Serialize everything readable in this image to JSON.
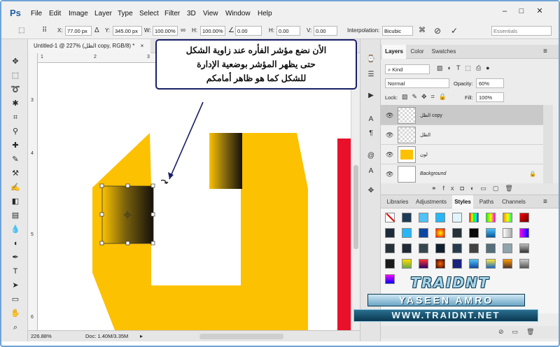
{
  "app": {
    "logo": "Ps",
    "menu": [
      "File",
      "Edit",
      "Image",
      "Layer",
      "Type",
      "Select",
      "Filter",
      "3D",
      "View",
      "Window",
      "Help"
    ],
    "window_controls": [
      "–",
      "□",
      "✕"
    ]
  },
  "options_bar": {
    "x_label": "X:",
    "x_value": "77.00 px",
    "y_label": "Y:",
    "y_value": "345.00 px",
    "w_label": "W:",
    "w_value": "100.00%",
    "h_label": "H:",
    "h_value": "100.00%",
    "angle_value": "0.00",
    "hskew_label": "H:",
    "hskew_value": "0.00",
    "vskew_label": "V:",
    "vskew_value": "0.00",
    "interp_label": "Interpolation:",
    "interp_value": "Bicubic",
    "workspace": "Essentials"
  },
  "document": {
    "tab_title": "Untitled-1 @ 227% (الظل copy, RGB/8) *",
    "tab_close": "×",
    "ruler_top": [
      "1",
      "2",
      "3",
      "4",
      "5",
      "6"
    ],
    "ruler_left": [
      "3",
      "4",
      "5",
      "6"
    ],
    "zoom": "226.88%",
    "doc_info": "Doc: 1.40M/3.35M"
  },
  "callout": {
    "lines": [
      "الأن نضع مؤشر الفأره عند زاوية الشكل",
      "حتى يظهر المؤشر بوضعية الإدارة",
      "للشكل كما هو ظاهر أمامكم"
    ]
  },
  "layers_panel": {
    "tabs": [
      "Layers",
      "Color",
      "Swatches"
    ],
    "kind_filter": "Kind",
    "blend_mode": "Normal",
    "opacity_label": "Opacity:",
    "opacity_value": "60%",
    "lock_label": "Lock:",
    "fill_label": "Fill:",
    "fill_value": "100%",
    "layers": [
      {
        "name": "الظل copy",
        "selected": true
      },
      {
        "name": "الظل",
        "selected": false
      },
      {
        "name": "لون",
        "selected": false
      },
      {
        "name": "Background",
        "selected": false
      }
    ]
  },
  "styles_panel": {
    "tabs": [
      "Libraries",
      "Adjustments",
      "Styles",
      "Paths",
      "Channels"
    ]
  },
  "watermark": {
    "line1": "TRAIDNT",
    "line2": "YASEEN AMRO",
    "line3": "WWW.TRAIDNT.NET"
  },
  "colors": {
    "logo_yellow": "#fcc100",
    "shadow_dark": "#14110a",
    "red_bar": "#e8102a",
    "callout_border": "#1a1f66",
    "selected_layer": "#c9c9c9"
  }
}
